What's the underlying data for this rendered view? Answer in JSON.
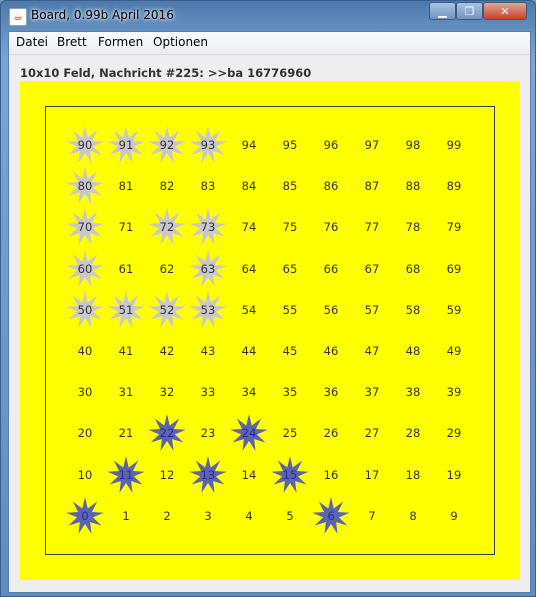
{
  "window": {
    "title": "Board, 0.99b April 2016",
    "minimize_label": "▁",
    "maximize_label": "❐",
    "close_label": "✕"
  },
  "menu": [
    "Datei",
    "Brett",
    "Formen",
    "Optionen"
  ],
  "status": "10x10 Feld, Nachricht #225: >>ba 16776960",
  "colors": {
    "board_background": "#ffff00",
    "star_blue": "#5c64b0",
    "star_gray": "#c8c8cc"
  },
  "board": {
    "rows": 10,
    "cols": 10,
    "grid": [
      [
        90,
        91,
        92,
        93,
        94,
        95,
        96,
        97,
        98,
        99
      ],
      [
        80,
        81,
        82,
        83,
        84,
        85,
        86,
        87,
        88,
        89
      ],
      [
        70,
        71,
        72,
        73,
        74,
        75,
        76,
        77,
        78,
        79
      ],
      [
        60,
        61,
        62,
        63,
        64,
        65,
        66,
        67,
        68,
        69
      ],
      [
        50,
        51,
        52,
        53,
        54,
        55,
        56,
        57,
        58,
        59
      ],
      [
        40,
        41,
        42,
        43,
        44,
        45,
        46,
        47,
        48,
        49
      ],
      [
        30,
        31,
        32,
        33,
        34,
        35,
        36,
        37,
        38,
        39
      ],
      [
        20,
        21,
        22,
        23,
        24,
        25,
        26,
        27,
        28,
        29
      ],
      [
        10,
        11,
        12,
        13,
        14,
        15,
        16,
        17,
        18,
        19
      ],
      [
        0,
        1,
        2,
        3,
        4,
        5,
        6,
        7,
        8,
        9
      ]
    ],
    "blue_stars": [
      0,
      6,
      11,
      13,
      15,
      22,
      24
    ],
    "gray_stars": [
      90,
      91,
      92,
      93,
      80,
      70,
      72,
      73,
      60,
      63,
      50,
      51,
      52,
      53
    ]
  }
}
